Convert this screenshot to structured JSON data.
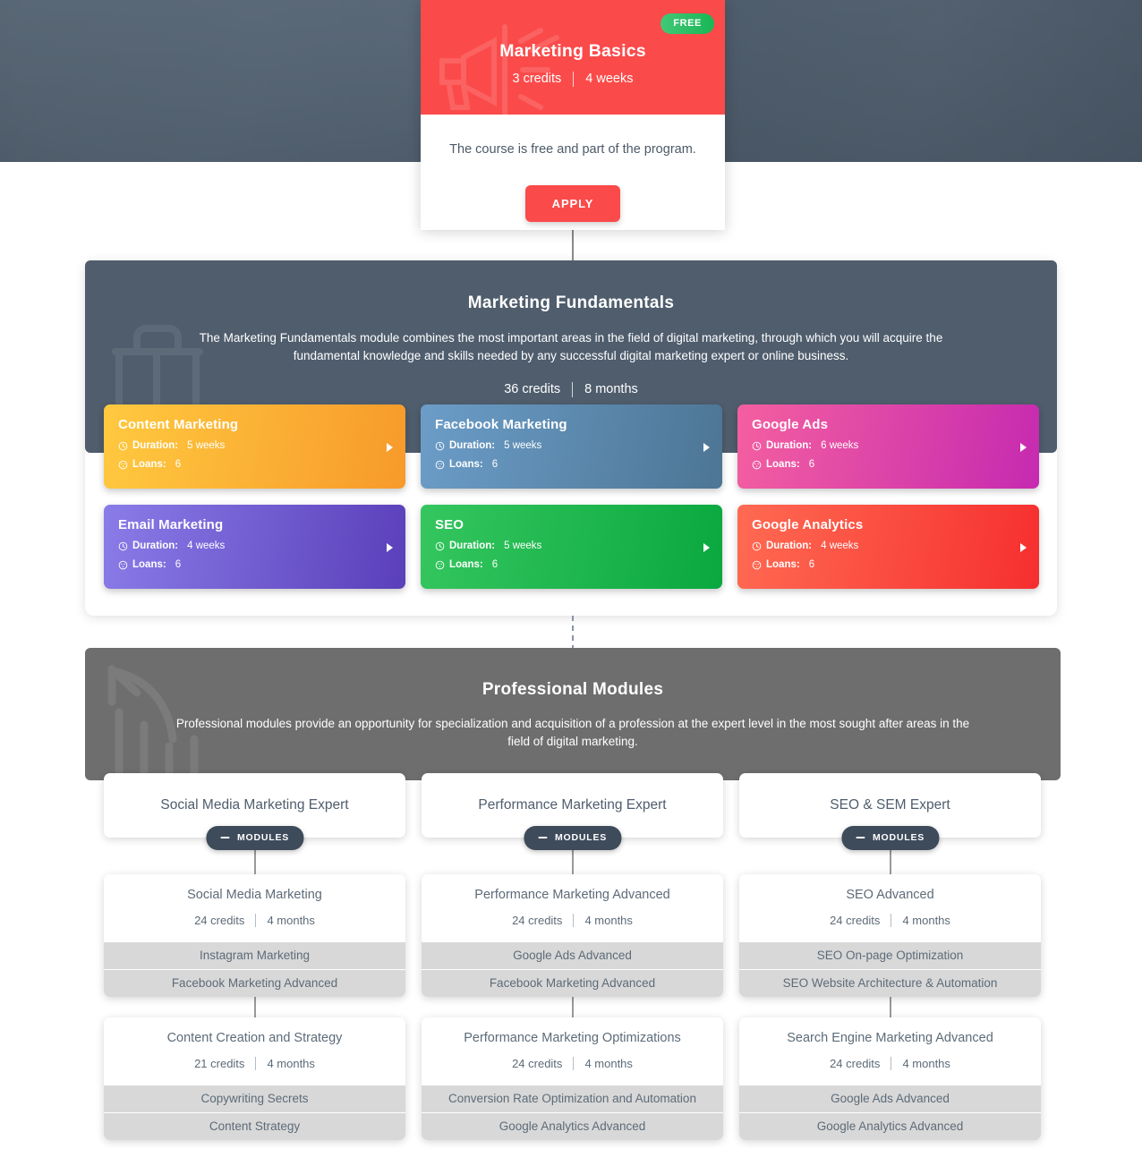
{
  "hero": {
    "card": {
      "badge": "FREE",
      "title": "Marketing Basics",
      "credits": "3 credits",
      "duration": "4 weeks",
      "description": "The course is free and part of the program.",
      "apply_label": "APPLY",
      "header_color": "#fb4a4a",
      "badge_color": "#18b755"
    }
  },
  "fundamentals": {
    "title": "Marketing Fundamentals",
    "description": "The Marketing Fundamentals module combines the most important areas in the field of digital marketing, through which you will acquire the fundamental knowledge and skills needed by any successful digital marketing expert or online business.",
    "credits": "36 credits",
    "duration": "8 months",
    "header_color": "#4f5d6d",
    "duration_label": "Duration:",
    "loans_label": "Loans:",
    "courses": [
      {
        "title": "Content Marketing",
        "duration": "5 weeks",
        "loans": "6",
        "color_from": "#ffc githubs"
      },
      {
        "title": "Facebook Marketing",
        "duration": "5 weeks",
        "loans": "6"
      },
      {
        "title": "Google Ads",
        "duration": "6 weeks",
        "loans": "6"
      },
      {
        "title": "Email Marketing",
        "duration": "4 weeks",
        "loans": "6"
      },
      {
        "title": "SEO",
        "duration": "5 weeks",
        "loans": "6"
      },
      {
        "title": "Google Analytics",
        "duration": "4 weeks",
        "loans": "6"
      }
    ]
  },
  "professional": {
    "title": "Professional Modules",
    "description": "Professional modules provide an opportunity for specialization and acquisition of a profession at the expert level in the most sought after areas in the field of digital marketing.",
    "header_color": "#6e6e6e",
    "modules_badge_label": "MODULES",
    "columns": [
      {
        "expert": "Social Media Marketing Expert",
        "modules": [
          {
            "name": "Social Media Marketing",
            "credits": "24 credits",
            "duration": "4 months",
            "courses": [
              "Instagram Marketing",
              "Facebook Marketing Advanced"
            ]
          },
          {
            "name": "Content Creation and Strategy",
            "credits": "21 credits",
            "duration": "4 months",
            "courses": [
              "Copywriting Secrets",
              "Content Strategy"
            ]
          }
        ]
      },
      {
        "expert": "Performance Marketing Expert",
        "modules": [
          {
            "name": "Performance Marketing Advanced",
            "credits": "24 credits",
            "duration": "4 months",
            "courses": [
              "Google Ads Advanced",
              "Facebook Marketing Advanced"
            ]
          },
          {
            "name": "Performance Marketing Optimizations",
            "credits": "24 credits",
            "duration": "4 months",
            "courses": [
              "Conversion Rate Optimization and Automation",
              "Google Analytics Advanced"
            ]
          }
        ]
      },
      {
        "expert": "SEO & SEM Expert",
        "modules": [
          {
            "name": "SEO Advanced",
            "credits": "24 credits",
            "duration": "4 months",
            "courses": [
              "SEO On-page Optimization",
              "SEO Website Architecture & Automation"
            ]
          },
          {
            "name": "Search Engine Marketing Advanced",
            "credits": "24 credits",
            "duration": "4 months",
            "courses": [
              "Google Ads Advanced",
              "Google Analytics Advanced"
            ]
          }
        ]
      }
    ]
  }
}
